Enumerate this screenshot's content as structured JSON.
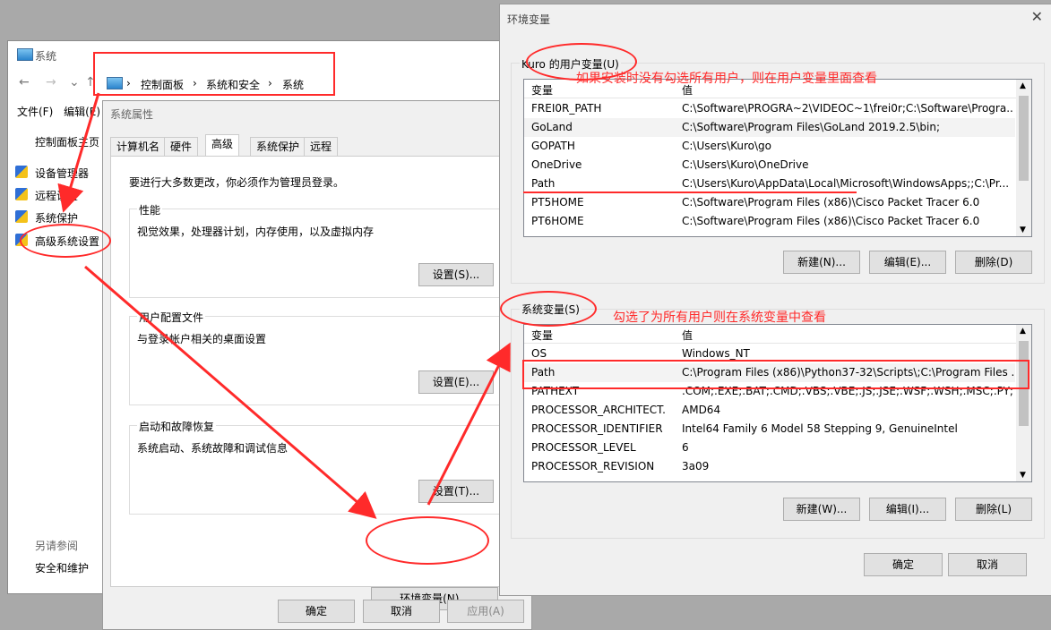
{
  "system_window": {
    "title": "系统",
    "breadcrumb": [
      "控制面板",
      "系统和安全",
      "系统"
    ],
    "menu": [
      "文件(F)",
      "编辑(E)"
    ],
    "sidebar": {
      "home": "控制面板主页",
      "items": [
        "设备管理器",
        "远程设置",
        "系统保护",
        "高级系统设置"
      ],
      "see_also": "另请参阅",
      "bottom": "安全和维护"
    }
  },
  "properties_dialog": {
    "title": "系统属性",
    "tabs": [
      "计算机名",
      "硬件",
      "高级",
      "系统保护",
      "远程"
    ],
    "active_tab": "高级",
    "notice": "要进行大多数更改，你必须作为管理员登录。",
    "performance": {
      "label": "性能",
      "desc": "视觉效果，处理器计划，内存使用，以及虚拟内存",
      "button": "设置(S)..."
    },
    "profile": {
      "label": "用户配置文件",
      "desc": "与登录帐户相关的桌面设置",
      "button": "设置(E)..."
    },
    "startup": {
      "label": "启动和故障恢复",
      "desc": "系统启动、系统故障和调试信息",
      "button": "设置(T)..."
    },
    "env_button": "环境变量(N)...",
    "ok": "确定",
    "cancel": "取消",
    "apply": "应用(A)"
  },
  "env_dialog": {
    "title": "环境变量",
    "close_glyph": "✕",
    "user_group": "Kuro 的用户变量(U)",
    "system_group": "系统变量(S)",
    "col_var": "变量",
    "col_val": "值",
    "user_vars": [
      [
        "FREI0R_PATH",
        "C:\\Software\\PROGRA~2\\VIDEOC~1\\frei0r;C:\\Software\\Progra..."
      ],
      [
        "GoLand",
        "C:\\Software\\Program Files\\GoLand 2019.2.5\\bin;"
      ],
      [
        "GOPATH",
        "C:\\Users\\Kuro\\go"
      ],
      [
        "OneDrive",
        "C:\\Users\\Kuro\\OneDrive"
      ],
      [
        "Path",
        "C:\\Users\\Kuro\\AppData\\Local\\Microsoft\\WindowsApps;;C:\\Pr..."
      ],
      [
        "PT5HOME",
        "C:\\Software\\Program Files (x86)\\Cisco Packet Tracer 6.0"
      ],
      [
        "PT6HOME",
        "C:\\Software\\Program Files (x86)\\Cisco Packet Tracer 6.0"
      ]
    ],
    "system_vars": [
      [
        "OS",
        "Windows_NT"
      ],
      [
        "Path",
        "C:\\Program Files (x86)\\Python37-32\\Scripts\\;C:\\Program Files ..."
      ],
      [
        "PATHEXT",
        ".COM;.EXE;.BAT;.CMD;.VBS;.VBE;.JS;.JSE;.WSF;.WSH;.MSC;.PY;.P..."
      ],
      [
        "PROCESSOR_ARCHITECT...",
        "AMD64"
      ],
      [
        "PROCESSOR_IDENTIFIER",
        "Intel64 Family 6 Model 58 Stepping 9, GenuineIntel"
      ],
      [
        "PROCESSOR_LEVEL",
        "6"
      ],
      [
        "PROCESSOR_REVISION",
        "3a09"
      ]
    ],
    "user_buttons": [
      "新建(N)...",
      "编辑(E)...",
      "删除(D)"
    ],
    "system_buttons": [
      "新建(W)...",
      "编辑(I)...",
      "删除(L)"
    ],
    "ok": "确定",
    "cancel": "取消"
  },
  "annotations": {
    "user_note": "如果安装时没有勾选所有用户，则在用户变量里面查看",
    "system_note": "勾选了为所有用户则在系统变量中查看"
  },
  "colors": {
    "annotation": "#ff2a2a"
  }
}
